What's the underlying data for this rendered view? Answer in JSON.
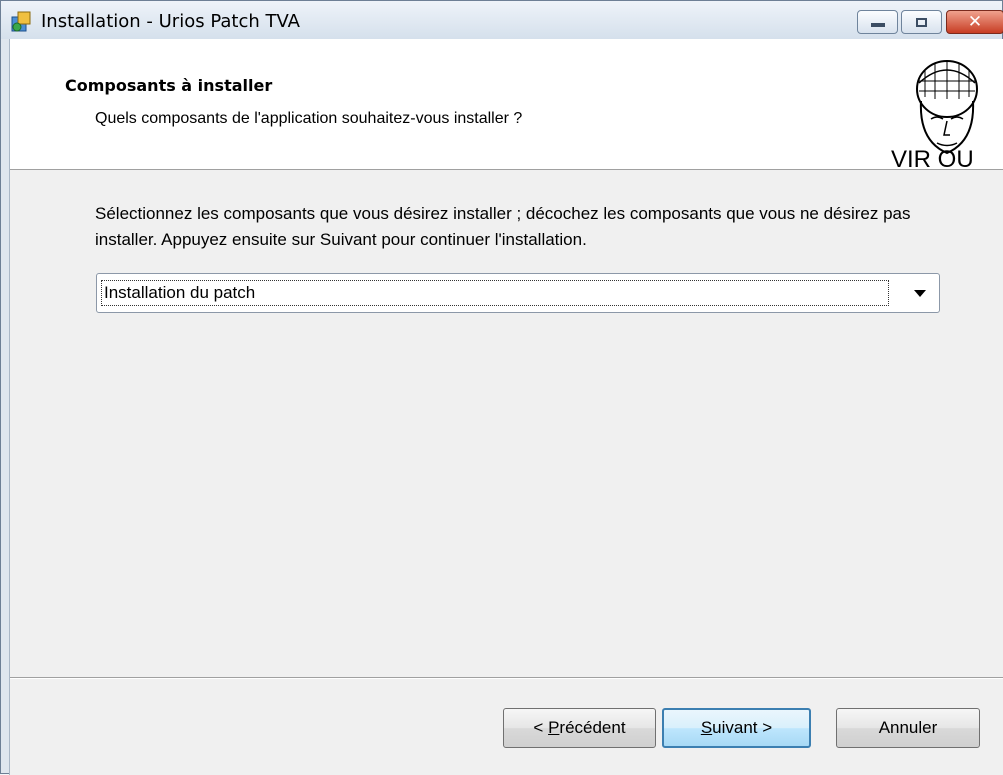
{
  "window": {
    "title": "Installation - Urios Patch TVA",
    "controls": {
      "minimize_icon": "minimize-icon",
      "maximize_icon": "maximize-icon",
      "close_icon": "close-icon",
      "close_glyph": "✕"
    }
  },
  "header": {
    "title": "Composants à installer",
    "subtitle": "Quels composants de l'application souhaitez-vous installer ?",
    "logo_text": "VIR OU"
  },
  "body": {
    "description": "Sélectionnez les composants que vous désirez installer ; décochez les composants que vous ne désirez pas installer. Appuyez ensuite sur Suivant pour continuer l'installation."
  },
  "components_select": {
    "selected": "Installation du patch"
  },
  "buttons": {
    "back": {
      "prefix": "< ",
      "accel": "P",
      "rest": "récédent"
    },
    "next": {
      "accel": "S",
      "rest": "uivant >"
    },
    "cancel": "Annuler"
  },
  "colors": {
    "accent": "#3c7fb1",
    "close_button": "#c73d24"
  }
}
